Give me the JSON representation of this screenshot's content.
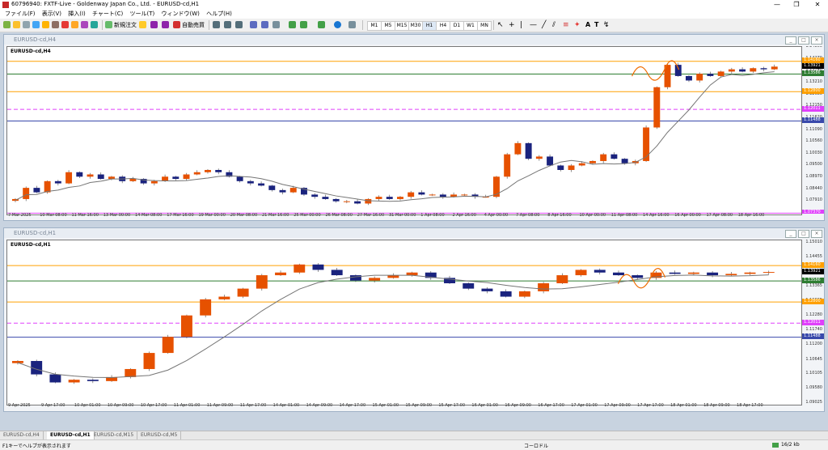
{
  "window": {
    "title": "60796940: FXTF-Live - Goldenway Japan Co., Ltd. - EURUSD-cd,H1"
  },
  "menu": [
    "ファイル(F)",
    "表示(V)",
    "挿入(I)",
    "チャート(C)",
    "ツール(T)",
    "ウィンドウ(W)",
    "ヘルプ(H)"
  ],
  "toolbar": {
    "new_order": "新規注文",
    "auto_trading": "自動売買",
    "timeframes": [
      "M1",
      "M5",
      "M15",
      "M30",
      "H1",
      "H4",
      "D1",
      "W1",
      "MN"
    ],
    "active_timeframe": "H1"
  },
  "colors": {
    "bull": "#e65100",
    "bear": "#1a237e",
    "ma": "#757575",
    "orange_line": "#ffa000",
    "green_line": "#2e7d32",
    "magenta_line": "#e040fb",
    "blue_line": "#3949ab",
    "black_label": "#000000",
    "annotation": "#ef6c00"
  },
  "charts": [
    {
      "title": "EURUSD-cd,H4",
      "symbol_label": "EURUSD-cd,H4",
      "ylim": [
        1.0731,
        1.148
      ],
      "price_ticks": [
        "1.14800",
        "1.14270",
        "1.13740",
        "1.13210",
        "1.12680",
        "1.12150",
        "1.11620",
        "1.11090",
        "1.10560",
        "1.10030",
        "1.09500",
        "1.08970",
        "1.08440",
        "1.07910"
      ],
      "time_ticks": [
        "7 Mar 2025",
        "10 Mar 08:00",
        "11 Mar 16:00",
        "13 Mar 00:00",
        "14 Mar 08:00",
        "17 Mar 16:00",
        "19 Mar 00:00",
        "20 Mar 08:00",
        "21 Mar 16:00",
        "25 Mar 00:00",
        "26 Mar 08:00",
        "27 Mar 16:00",
        "31 Mar 00:00",
        "1 Apr 08:00",
        "2 Apr 16:00",
        "4 Apr 00:00",
        "7 Apr 08:00",
        "8 Apr 16:00",
        "10 Apr 00:00",
        "11 Apr 08:00",
        "14 Apr 16:00",
        "16 Apr 00:00",
        "17 Apr 08:00",
        "18 Apr 16:00"
      ],
      "levels": [
        {
          "price": 1.1416,
          "label": "1.14160",
          "color": "orange",
          "style": "solid"
        },
        {
          "price": 1.13921,
          "label": "1.13921",
          "color": "black",
          "style": "solid"
        },
        {
          "price": 1.13586,
          "label": "1.13586",
          "color": "green",
          "style": "solid"
        },
        {
          "price": 1.128,
          "label": "1.12800",
          "color": "orange",
          "style": "solid"
        },
        {
          "price": 1.12011,
          "label": "1.12011",
          "color": "magenta",
          "style": "dashed"
        },
        {
          "price": 1.11488,
          "label": "1.11488",
          "color": "blue",
          "style": "solid"
        },
        {
          "price": 1.0737,
          "label": "1.07370",
          "color": "magenta",
          "style": "solid"
        }
      ],
      "chart_data": {
        "type": "candlestick",
        "series_close": [
          1.08,
          1.085,
          1.083,
          1.088,
          1.087,
          1.092,
          1.09,
          1.091,
          1.089,
          1.09,
          1.088,
          1.089,
          1.087,
          1.088,
          1.09,
          1.089,
          1.091,
          1.092,
          1.093,
          1.092,
          1.09,
          1.088,
          1.087,
          1.086,
          1.084,
          1.083,
          1.085,
          1.082,
          1.081,
          1.08,
          1.079,
          1.079,
          1.078,
          1.08,
          1.081,
          1.08,
          1.081,
          1.083,
          1.082,
          1.082,
          1.081,
          1.082,
          1.082,
          1.081,
          1.081,
          1.09,
          1.1,
          1.105,
          1.098,
          1.099,
          1.095,
          1.093,
          1.095,
          1.096,
          1.097,
          1.1,
          1.098,
          1.096,
          1.097,
          1.112,
          1.13,
          1.14,
          1.135,
          1.133,
          1.136,
          1.135,
          1.137,
          1.138,
          1.137,
          1.1385,
          1.138,
          1.1392
        ]
      }
    },
    {
      "title": "EURUSD-cd,H1",
      "symbol_label": "EURUSD-cd,H1",
      "ylim": [
        1.0897,
        1.151
      ],
      "price_ticks": [
        "1.15010",
        "1.14455",
        "1.13920",
        "1.13365",
        "1.12835",
        "1.12280",
        "1.11740",
        "1.11200",
        "1.10645",
        "1.10105",
        "1.09580",
        "1.09025"
      ],
      "time_ticks": [
        "9 Apr 2025",
        "9 Apr 17:00",
        "10 Apr 01:00",
        "10 Apr 09:00",
        "10 Apr 17:00",
        "11 Apr 01:00",
        "11 Apr 09:00",
        "11 Apr 17:00",
        "14 Apr 01:00",
        "14 Apr 09:00",
        "14 Apr 17:00",
        "15 Apr 01:00",
        "15 Apr 09:00",
        "15 Apr 17:00",
        "16 Apr 01:00",
        "16 Apr 09:00",
        "16 Apr 17:00",
        "17 Apr 01:00",
        "17 Apr 09:00",
        "17 Apr 17:00",
        "18 Apr 01:00",
        "18 Apr 09:00",
        "18 Apr 17:00"
      ],
      "levels": [
        {
          "price": 1.1416,
          "label": "1.14160",
          "color": "orange",
          "style": "solid"
        },
        {
          "price": 1.13921,
          "label": "1.13921",
          "color": "black",
          "style": "solid"
        },
        {
          "price": 1.13586,
          "label": "1.13586",
          "color": "green",
          "style": "solid"
        },
        {
          "price": 1.128,
          "label": "1.12800",
          "color": "orange",
          "style": "solid"
        },
        {
          "price": 1.12011,
          "label": "1.12011",
          "color": "magenta",
          "style": "dashed"
        },
        {
          "price": 1.11488,
          "label": "1.11488",
          "color": "blue",
          "style": "solid"
        }
      ],
      "chart_data": {
        "type": "candlestick",
        "series_close": [
          1.106,
          1.101,
          1.098,
          1.099,
          1.0985,
          1.1,
          1.103,
          1.109,
          1.115,
          1.123,
          1.129,
          1.13,
          1.133,
          1.138,
          1.139,
          1.142,
          1.14,
          1.138,
          1.136,
          1.137,
          1.138,
          1.139,
          1.137,
          1.135,
          1.133,
          1.132,
          1.13,
          1.132,
          1.135,
          1.138,
          1.14,
          1.139,
          1.138,
          1.137,
          1.139,
          1.1385,
          1.139,
          1.138,
          1.1385,
          1.139,
          1.1392
        ]
      }
    }
  ],
  "tabs": [
    "EURUSD-cd,H4",
    "EURUSD-cd,H1",
    "EURUSD-cd,M15",
    "EURUSD-cd,M5"
  ],
  "active_tab": "EURUSD-cd,H1",
  "status": {
    "help": "F1キーでヘルプが表示されます",
    "profile": "コーロドル",
    "traffic": "16/2 kb"
  }
}
